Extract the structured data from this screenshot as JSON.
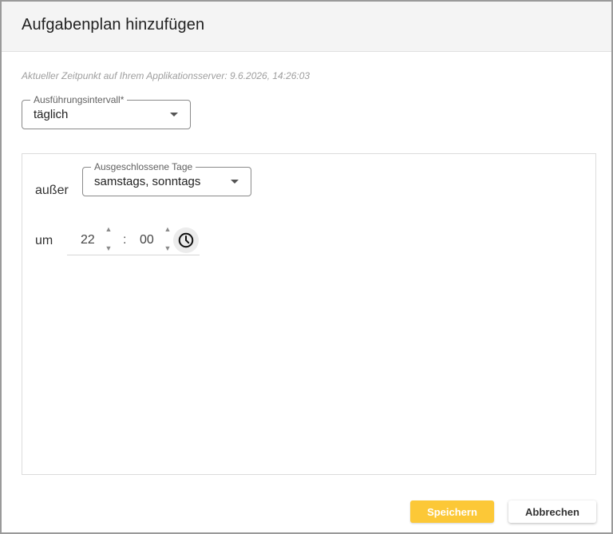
{
  "dialog": {
    "title": "Aufgabenplan hinzufügen",
    "server_time_text": "Aktueller Zeitpunkt auf Ihrem Applikationsserver: 9.6.2026, 14:26:03"
  },
  "interval": {
    "label": "Ausführungsintervall*",
    "value": "täglich"
  },
  "schedule": {
    "except_label": "außer",
    "excluded_days_label": "Ausgeschlossene Tage",
    "excluded_days_value": "samstags, sonntags",
    "at_label": "um",
    "hour": "22",
    "minute": "00",
    "separator": ":"
  },
  "icons": {
    "caret": "caret-down-icon",
    "spin_up": "▲",
    "spin_down": "▼",
    "clock": "clock-icon"
  },
  "buttons": {
    "save_label": "Speichern",
    "cancel_label": "Abbrechen"
  },
  "colors": {
    "accent": "#fcc837",
    "header_bg": "#f4f4f4"
  }
}
